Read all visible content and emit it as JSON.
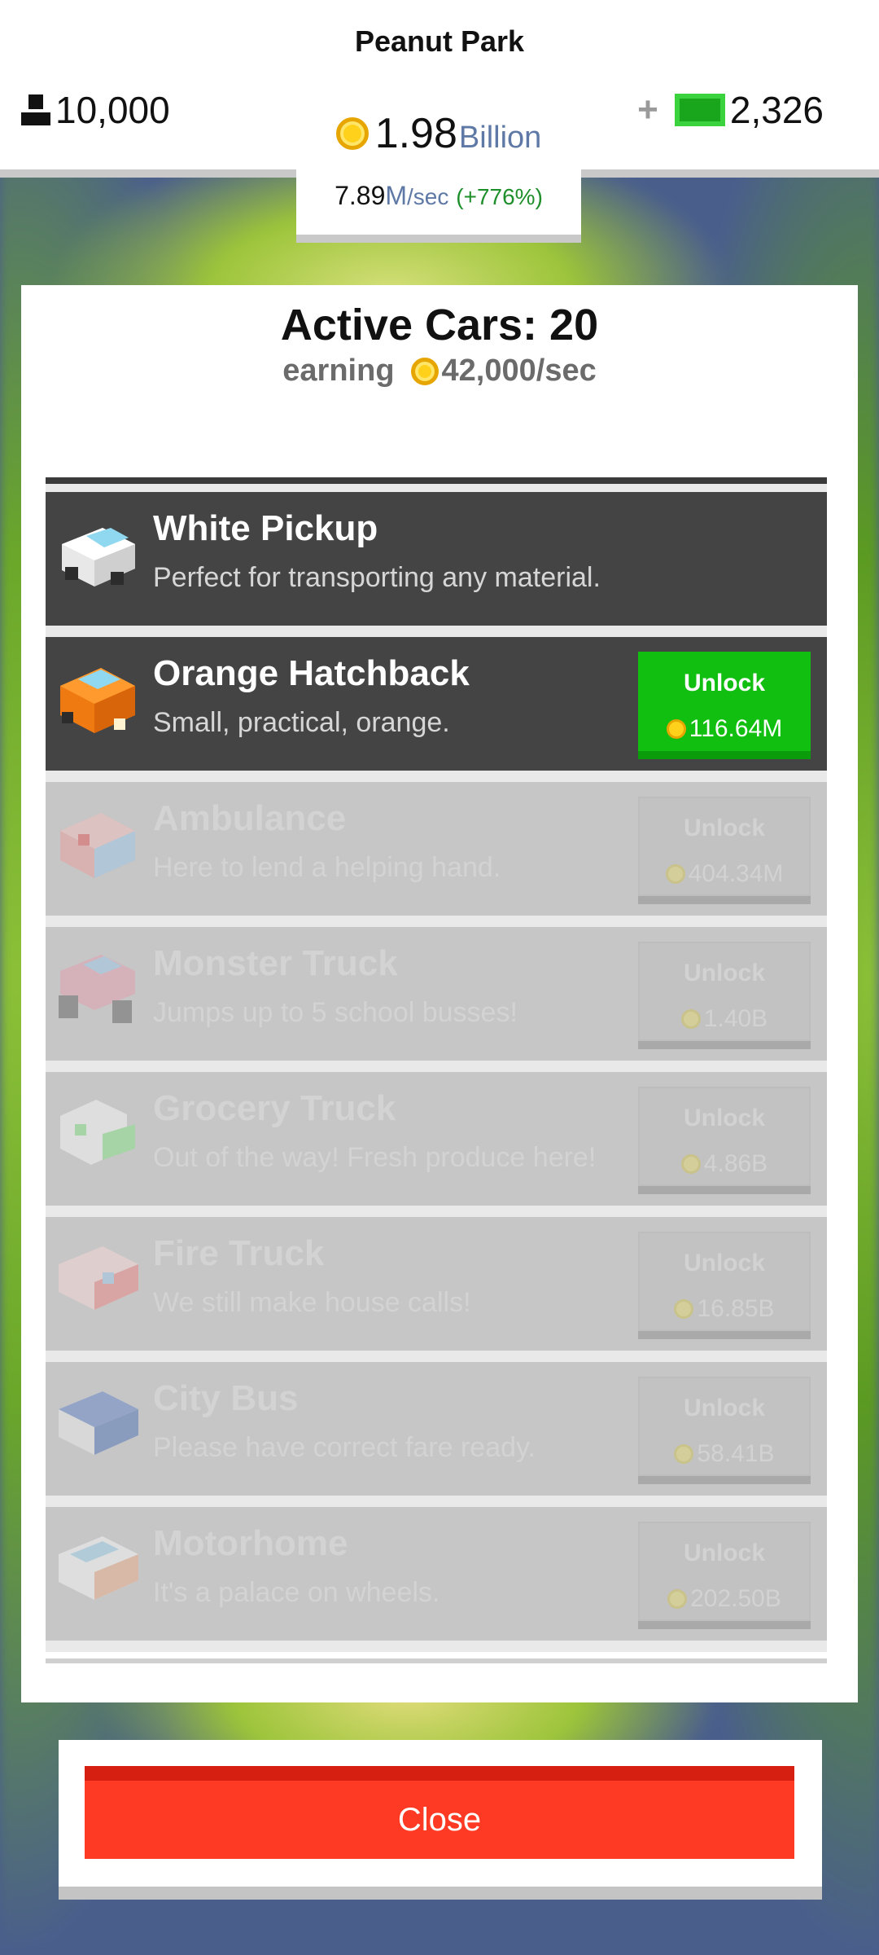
{
  "header": {
    "park_name": "Peanut Park",
    "visitors": "10,000",
    "coins_value": "1.98",
    "coins_unit": "Billion",
    "rate_value": "7.89",
    "rate_unit": "M",
    "rate_suffix": "/sec",
    "rate_change": "(+776%)",
    "plus": "+",
    "cash": "2,326"
  },
  "panel": {
    "title": "Active Cars: 20",
    "earning_label": "earning",
    "earning_value": "42,000/sec"
  },
  "cars": [
    {
      "name": "White Pickup",
      "desc": "Perfect for transporting any material.",
      "state": "owned"
    },
    {
      "name": "Orange Hatchback",
      "desc": "Small, practical, orange.",
      "state": "available",
      "button": "Unlock",
      "price": "116.64M"
    },
    {
      "name": "Ambulance",
      "desc": "Here to lend a helping hand.",
      "state": "locked",
      "button": "Unlock",
      "price": "404.34M"
    },
    {
      "name": "Monster Truck",
      "desc": "Jumps up to 5 school busses!",
      "state": "locked",
      "button": "Unlock",
      "price": "1.40B"
    },
    {
      "name": "Grocery Truck",
      "desc": "Out of the way! Fresh produce here!",
      "state": "locked",
      "button": "Unlock",
      "price": "4.86B"
    },
    {
      "name": "Fire Truck",
      "desc": "We still make house calls!",
      "state": "locked",
      "button": "Unlock",
      "price": "16.85B"
    },
    {
      "name": "City Bus",
      "desc": "Please have correct fare ready.",
      "state": "locked",
      "button": "Unlock",
      "price": "58.41B"
    },
    {
      "name": "Motorhome",
      "desc": "It's a palace on wheels.",
      "state": "locked",
      "button": "Unlock",
      "price": "202.50B"
    }
  ],
  "footer": {
    "close_label": "Close"
  },
  "colors": {
    "unlock_green": "#10bf10",
    "close_red": "#ff3a24",
    "background_blue": "#4a5e8c"
  }
}
